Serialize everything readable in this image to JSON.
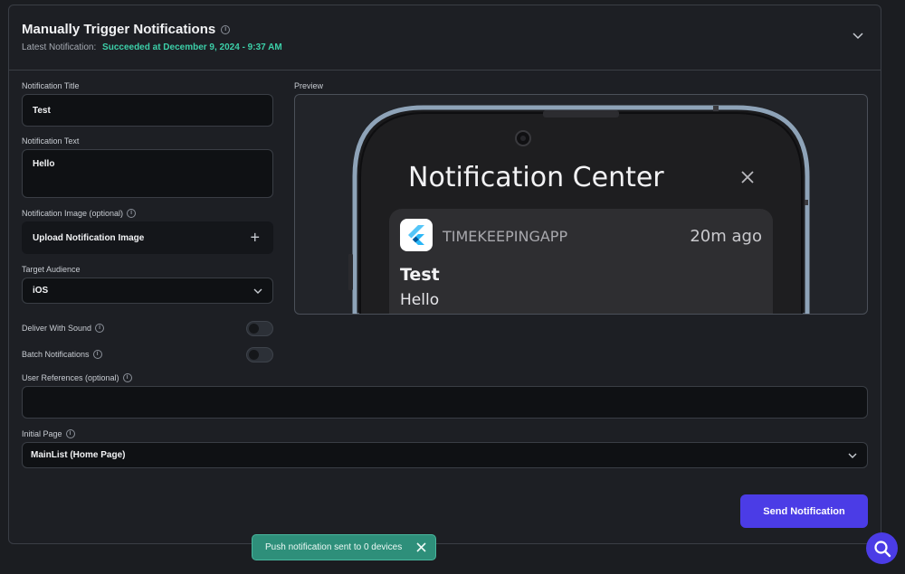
{
  "header": {
    "title": "Manually Trigger Notifications",
    "latest_label": "Latest Notification:",
    "latest_status": "Succeeded at December 9, 2024 - 9:37 AM"
  },
  "form": {
    "title_label": "Notification Title",
    "title_value": "Test",
    "text_label": "Notification Text",
    "text_value": "Hello",
    "image_label": "Notification Image (optional)",
    "image_button": "Upload Notification Image",
    "audience_label": "Target Audience",
    "audience_value": "iOS",
    "sound_label": "Deliver With Sound",
    "sound_on": false,
    "batch_label": "Batch Notifications",
    "batch_on": false,
    "refs_label": "User References (optional)",
    "refs_value": "",
    "page_label": "Initial Page",
    "page_value": "MainList (Home Page)"
  },
  "preview": {
    "label": "Preview",
    "center_title": "Notification Center",
    "app_name": "TIMEKEEPINGAPP",
    "time_ago": "20m ago",
    "notif_title": "Test",
    "notif_body": "Hello"
  },
  "actions": {
    "send": "Send Notification"
  },
  "toast": {
    "message": "Push notification sent to 0 devices"
  },
  "colors": {
    "accent": "#4b3ce6",
    "success": "#3ccfa8",
    "toast_bg": "#2e8f7a"
  }
}
